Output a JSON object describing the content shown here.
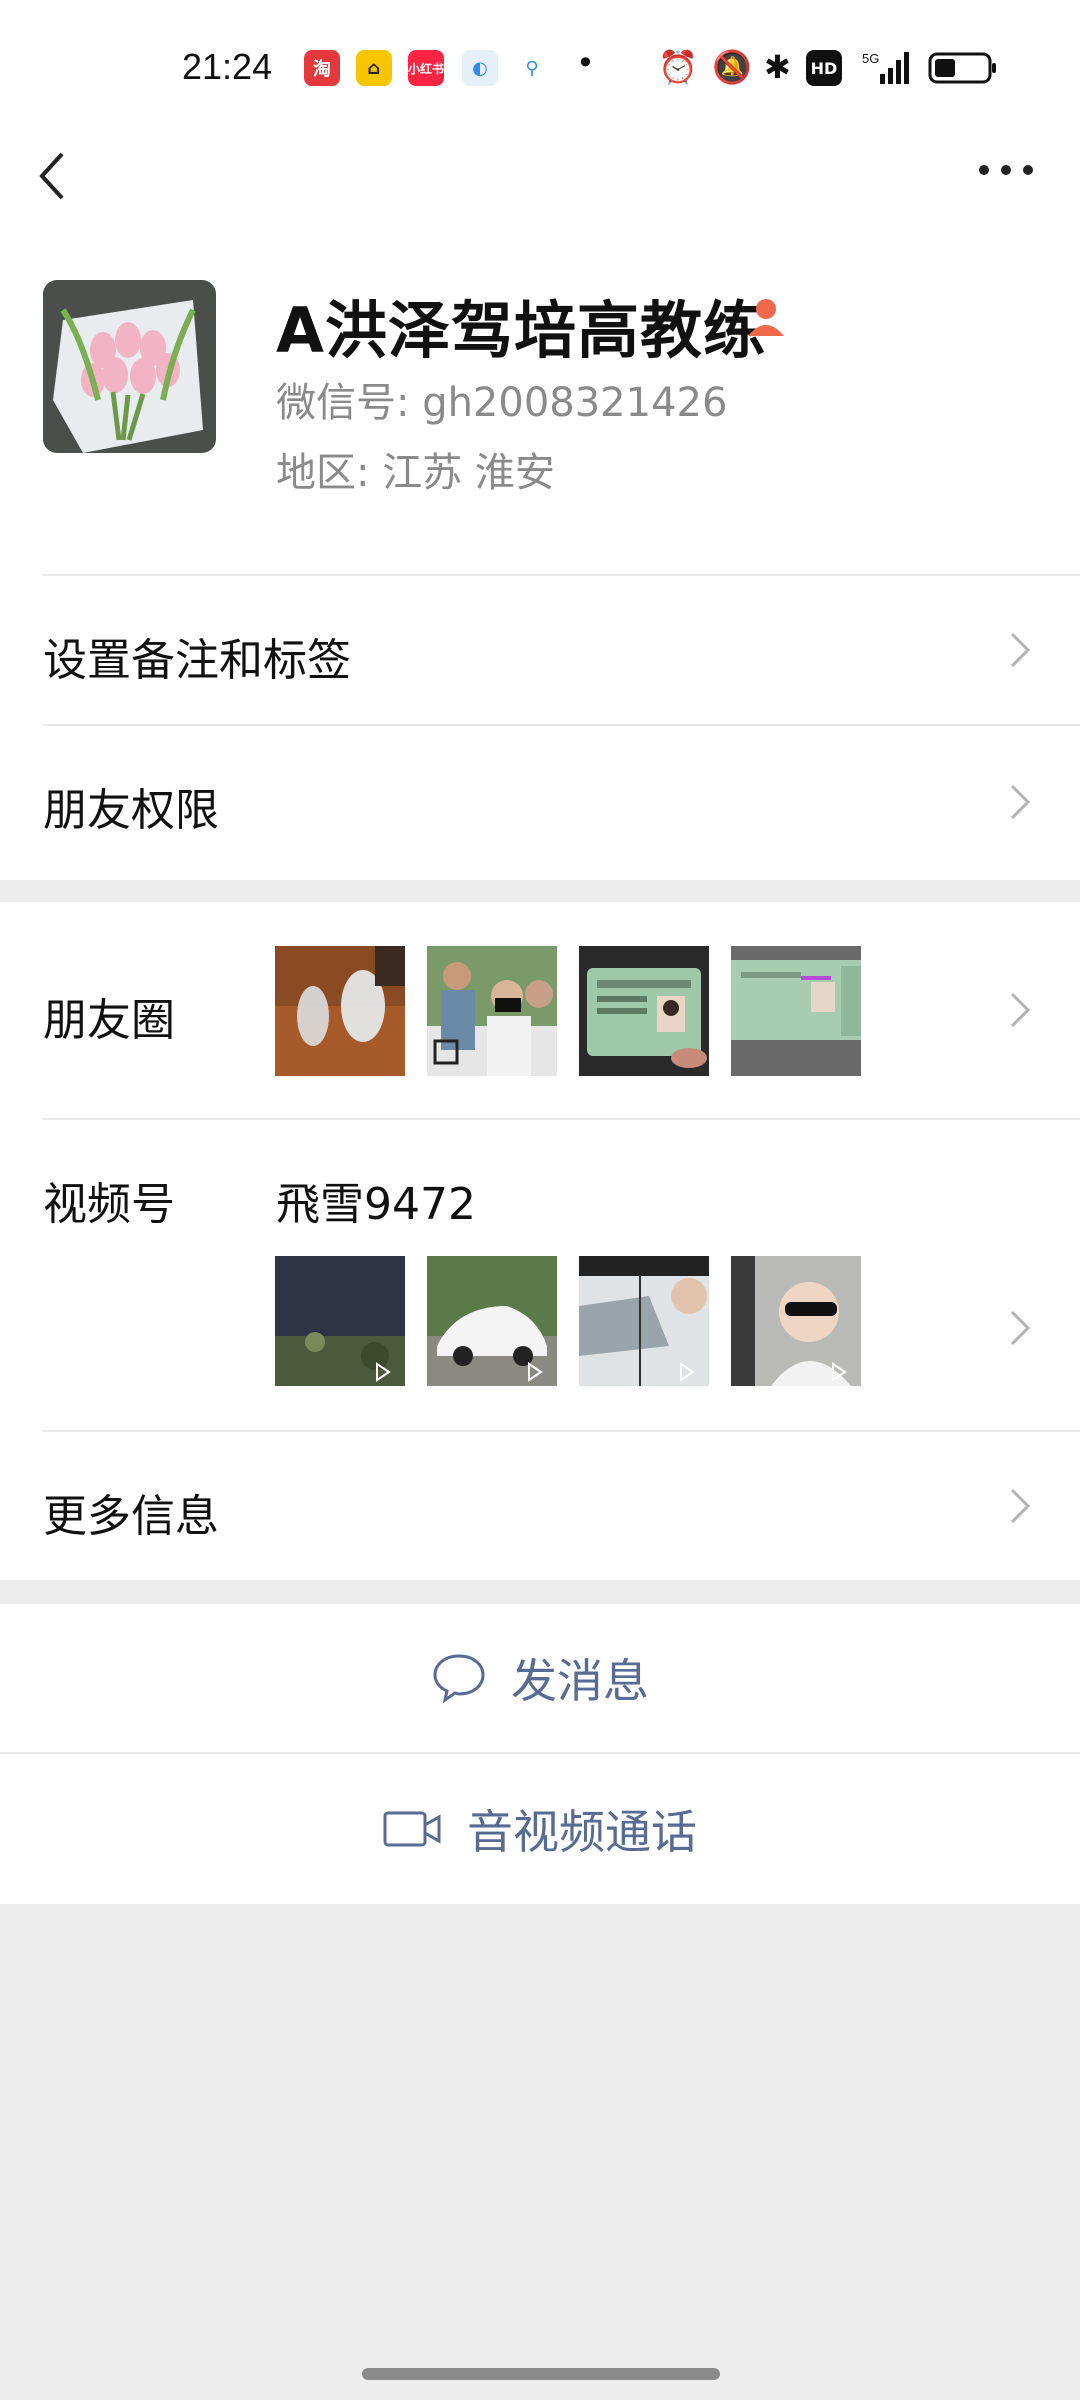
{
  "status_bar": {
    "time": "21:24",
    "app_icons": [
      "taobao-icon",
      "car-icon",
      "xiaohongshu-icon",
      "browser-icon",
      "search-app-icon"
    ],
    "xiaohongshu_text": "小红书",
    "right_icons": [
      "alarm-icon",
      "mute-icon",
      "bluetooth-icon",
      "hd-icon",
      "5g-signal-icon",
      "battery-icon"
    ],
    "hd_text": "HD",
    "network": "5G"
  },
  "nav": {
    "back": "back-icon",
    "more": "more-icon"
  },
  "profile": {
    "name": "A洪泽驾培高教练",
    "wechat_id": "微信号: gh2008321426",
    "region": "地区: 江苏  淮安"
  },
  "menu": {
    "remark": "设置备注和标签",
    "permissions": "朋友权限",
    "moments": "朋友圈",
    "channels": "视频号",
    "channels_name": "飛雪9472",
    "more_info": "更多信息"
  },
  "actions": {
    "message": "发消息",
    "call": "音视频通话"
  },
  "colors": {
    "accent": "#576b95",
    "background": "#ededed",
    "person_icon": "#ee6a4a"
  }
}
